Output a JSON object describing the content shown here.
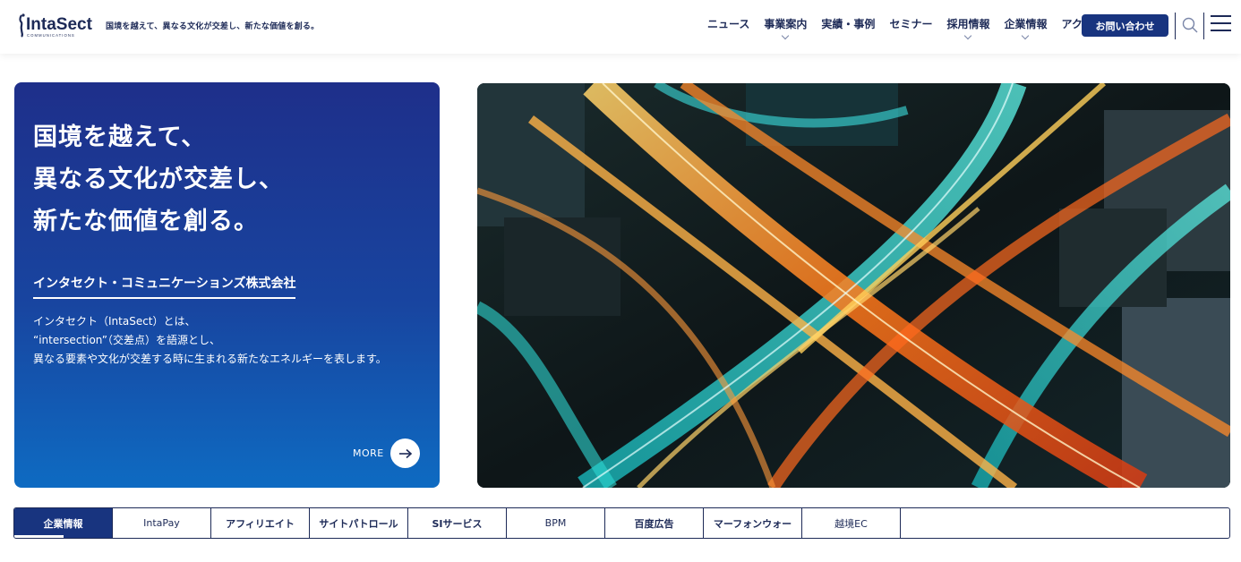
{
  "header": {
    "logo_text": "IntaSect",
    "logo_subtext": "COMMUNICATIONS",
    "tagline": "国境を越えて、異なる文化が交差し、新たな価値を創る。",
    "nav": [
      {
        "label": "ニュース",
        "has_dropdown": false
      },
      {
        "label": "事業案内",
        "has_dropdown": true
      },
      {
        "label": "実績・事例",
        "has_dropdown": false
      },
      {
        "label": "セミナー",
        "has_dropdown": false
      },
      {
        "label": "採用情報",
        "has_dropdown": true
      },
      {
        "label": "企業情報",
        "has_dropdown": true
      },
      {
        "label": "アクセス",
        "has_dropdown": false
      }
    ],
    "contact_label": "お問い合わせ",
    "search_icon": "search-icon",
    "menu_icon": "hamburger-menu-icon"
  },
  "hero": {
    "headline": [
      "国境を越えて、",
      "異なる文化が交差し、",
      "新たな価値を創る。"
    ],
    "company_name": "インタセクト・コミュニケーションズ株式会社",
    "description": [
      "インタセクト（IntaSect）とは、",
      "“intersection”（交差点）を語源とし、",
      "異なる要素や文化が交差する時に生まれる新たなエネルギーを表します。"
    ],
    "more_label": "MORE",
    "more_icon": "arrow-right-icon",
    "image_alt": "aerial night view of highway intersection with light trails"
  },
  "tabs": [
    {
      "label": "企業情報",
      "active": true
    },
    {
      "label": "IntaPay",
      "active": false
    },
    {
      "label": "アフィリエイト",
      "active": false
    },
    {
      "label": "サイトパトロール",
      "active": false
    },
    {
      "label": "SIサービス",
      "active": false
    },
    {
      "label": "BPM",
      "active": false
    },
    {
      "label": "百度広告",
      "active": false
    },
    {
      "label": "マーフォンウォー",
      "active": false
    },
    {
      "label": "越境EC",
      "active": false
    }
  ],
  "colors": {
    "brand_navy": "#1d2a57",
    "button_blue": "#18347f",
    "hero_gradient_top": "#1e2f8a",
    "hero_gradient_bottom": "#0e6bc2"
  }
}
